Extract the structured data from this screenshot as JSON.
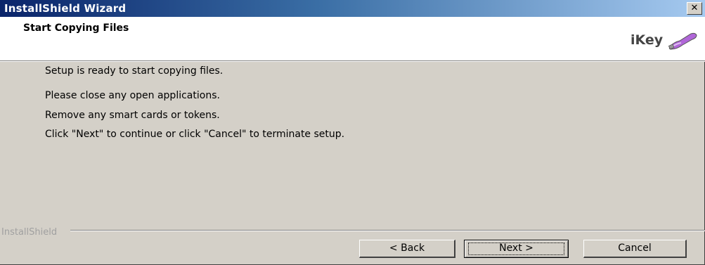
{
  "window": {
    "title": "InstallShield Wizard",
    "close_glyph": "✕"
  },
  "header": {
    "heading": "Start Copying Files",
    "logo_text": "iKey",
    "logo_icon": "usb-key-icon"
  },
  "content": {
    "lines": [
      "Setup is ready to start copying files.",
      "Please close any open applications.",
      "Remove any smart cards or tokens.",
      "Click \"Next\" to continue or click \"Cancel\" to terminate setup."
    ]
  },
  "footer": {
    "brand": "InstallShield",
    "buttons": {
      "back": "< Back",
      "next": "Next >",
      "cancel": "Cancel"
    }
  },
  "colors": {
    "titlebar_start": "#0a246a",
    "titlebar_end": "#a6caf0",
    "dialog_face": "#d4d0c8",
    "logo_accent": "#b066d8"
  }
}
